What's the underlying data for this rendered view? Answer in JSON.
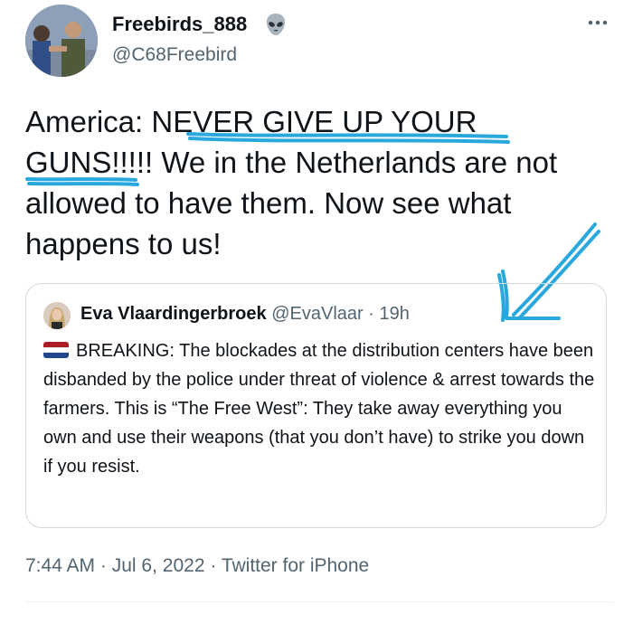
{
  "author": {
    "display_name": "Freebirds_888",
    "handle": "@C68Freebird",
    "badge_icon": "alien-emoji-icon"
  },
  "tweet": {
    "text_prefix": "America: ",
    "text_highlight1": "NEVER GIVE UP YOUR",
    "text_highlight2": "GUNS",
    "text_rest": "!!!!! We in the Netherlands are not allowed to have them. Now see what happens to us!"
  },
  "quoted_tweet": {
    "display_name": "Eva Vlaardingerbroek",
    "handle": "@EvaVlaar",
    "separator": "·",
    "time_ago": "19h",
    "flag_icon": "netherlands-flag-icon",
    "text": "BREAKING: The blockades at the distribution centers have been disbanded by the police under threat of violence & arrest towards the farmers. This is “The Free West”: They take away everything you own and use their weapons (that you don’t have) to strike you down if you resist."
  },
  "footer": {
    "time": "7:44 AM",
    "dot1": "·",
    "date": "Jul 6, 2022",
    "dot2": "·",
    "source": "Twitter for iPhone"
  },
  "colors": {
    "text_primary": "#0f1419",
    "text_secondary": "#536471",
    "annotation_blue": "#29a8de",
    "border": "#cfd9de",
    "flag_red": "#ae1c28",
    "flag_white": "#ffffff",
    "flag_blue": "#21468b"
  }
}
